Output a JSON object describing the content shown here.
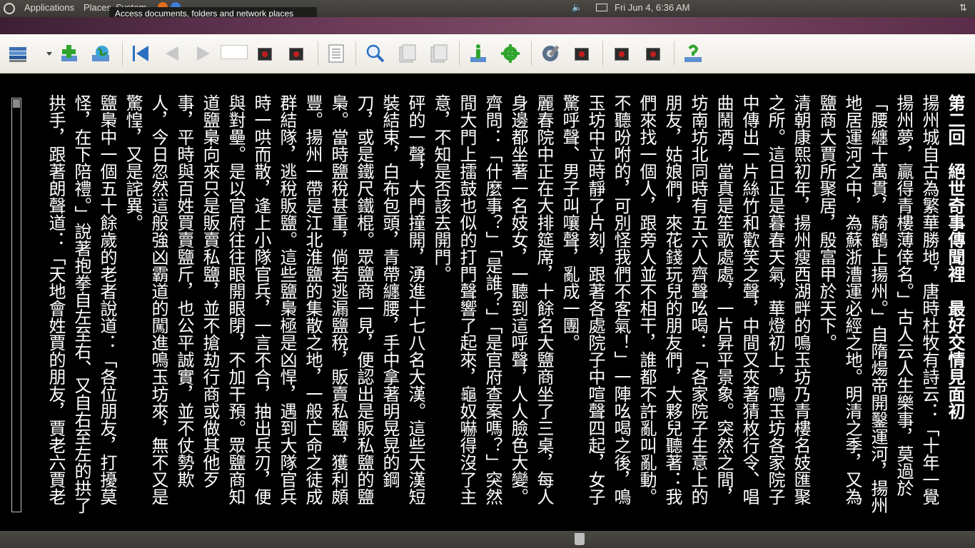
{
  "top_panel": {
    "applications": "Applications",
    "places": "Places",
    "system": "System",
    "clock": "Fri Jun  4,  6:36 AM"
  },
  "tooltip": "Access documents, folders and network places",
  "toolbar": {
    "page_value": "",
    "icons": [
      "library-icon",
      "add-book-icon",
      "globe-icon",
      "first-page-icon",
      "prev-page-icon",
      "next-page-icon",
      "stop-icon",
      "stop-icon",
      "document-icon",
      "find-icon",
      "copy-icon",
      "copy-icon",
      "info-icon",
      "settings-icon",
      "gear-tool-icon",
      "stop-icon",
      "stop-icon",
      "stop-icon",
      "help-icon"
    ]
  },
  "book": {
    "chapter_title": "第二回　絕世奇事傳聞裡　最好交情見面初",
    "paragraphs": [
      "揚州城自古為繁華勝地，唐時杜牧有詩云：「十年一覺揚州夢，贏得青樓薄倖名。」古人云人生樂事，莫過於「腰纏十萬貫，騎鶴上揚州。」自隋煬帝開鑿運河，揚州地居運河之中，為蘇浙漕運必經之地。明清之季，又為鹽商大賈所聚居，殷富甲於天下。",
      "清朝康熙初年，揚州瘦西湖畔的鳴玉坊乃青樓名妓匯聚之所。這日正是暮春天氣，華燈初上，鳴玉坊各家院子中傳出一片絲竹和歡笑之聲，中間又夾著猜枚行令、唱曲鬧酒，當真是笙歌處處，一片昇平景象。突然之間，坊南坊北同時有五六人齊聲吆喝：「各家院子生意上的朋友，姑娘們，來花錢玩兒的朋友們，大夥兒聽著：我們來找一個人，跟旁人並不相干，誰都不許亂叫亂動。不聽吩咐的，可別怪我們不客氣！」一陣吆喝之後，鳴玉坊中立時靜了片刻，跟著各處院子中喧聲四起，女子驚呼聲、男子叫嚷聲，亂成一團。",
      "麗春院中正在大排筵席，十餘名大鹽商坐了三桌，每人身邊都坐著一名妓女，一聽到這呼聲，人人臉色大變。齊問：「什麼事？」「是誰？」「是官府查案嗎？」突然間大門上擂鼓也似的打門聲響了起來，龜奴嚇得沒了主意，不知是否該去開門。",
      "砰的一聲，大門撞開，湧進十七八名大漢。這些大漢短裝結束，白布包頭，青帶纏腰，手中拿著明晃晃的鋼刀，或是鐵尺鐵棍。眾鹽商一見，便認出是販私鹽的鹽梟。當時鹽稅甚重，倘若逃漏鹽稅，販賣私鹽，獲利頗豐。揚州一帶是江北淮鹽的集散之地，一般亡命之徒成群結隊，逃稅販鹽。這些鹽梟極是凶悍，遇到大隊官兵時一哄而散，逢上小隊官兵，一言不合，抽出兵刃，便與對壘。是以官府往往眼開眼閉，不加干預。眾鹽商知道鹽梟向來只是販賣私鹽，並不搶劫行商或做其他歹事，平時與百姓買賣鹽斤，也公平誠實，並不仗勢欺人，今日忽然這般強凶霸道的闖進鳴玉坊來，無不又是驚惶，又是詫異。",
      "鹽梟中一個五十餘歲的老者說道：「各位朋友，打擾莫怪，在下陪禮。」說著抱拳自左至右、又自右至左的拱了拱手，跟著朗聲道：「天地會姓賈的朋友，賈老六賈老"
    ]
  }
}
